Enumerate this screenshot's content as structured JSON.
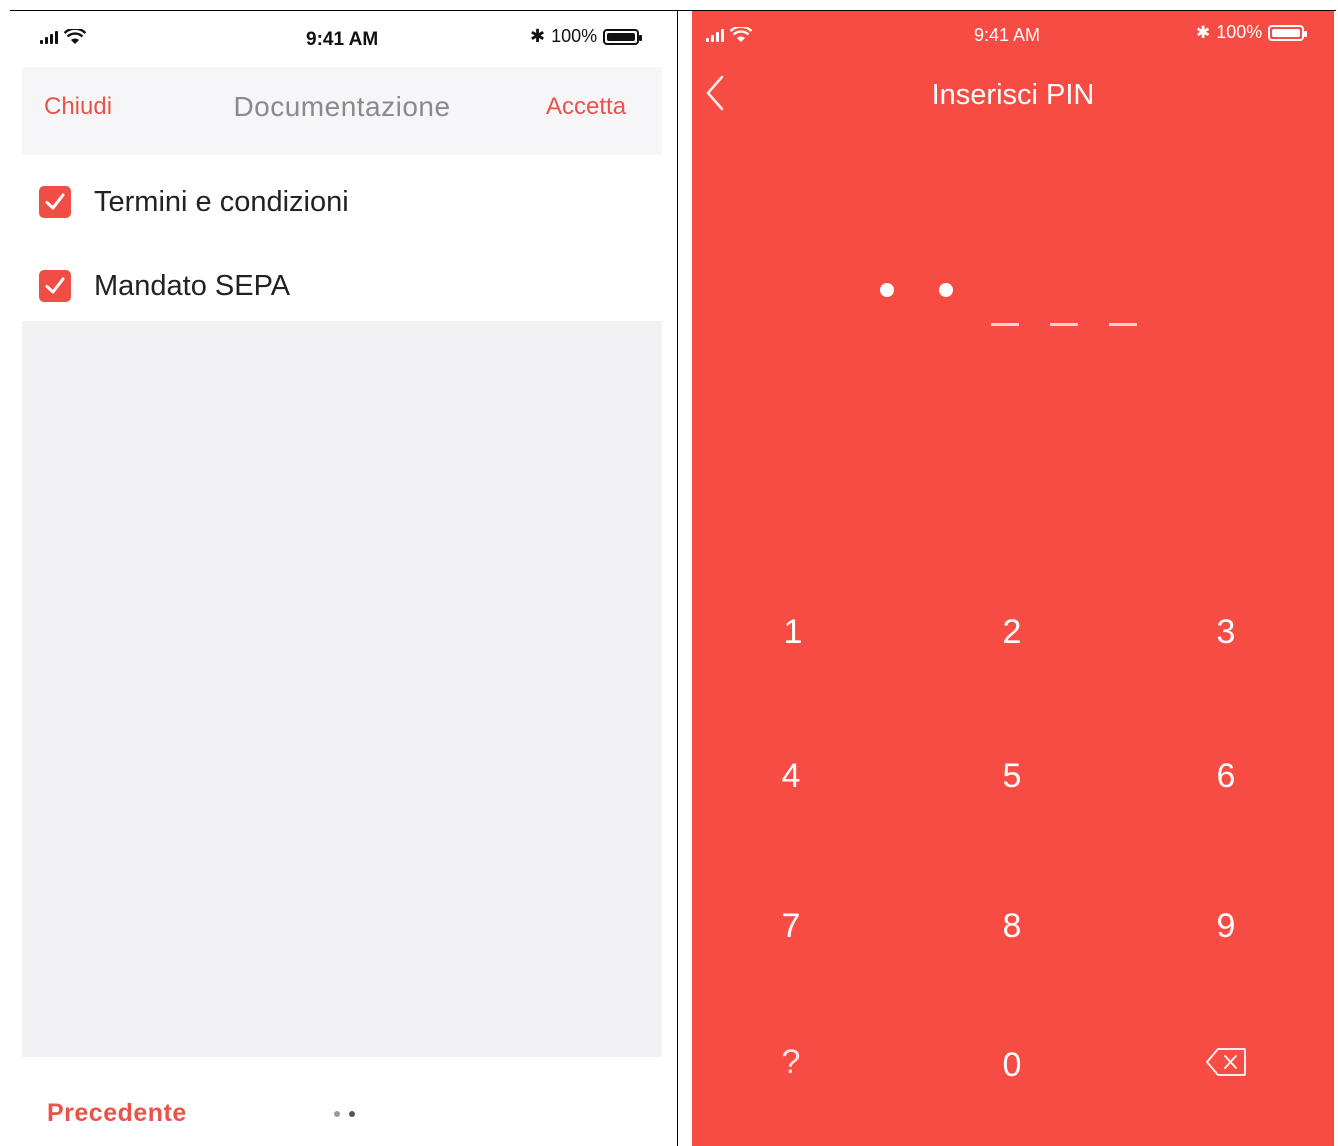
{
  "left_screen": {
    "status_bar": {
      "time": "9:41 AM",
      "battery": "100%"
    },
    "nav": {
      "close": "Chiudi",
      "title": "Documentazione",
      "accept": "Accetta"
    },
    "documents": [
      {
        "label": "Termini e condizioni",
        "checked": true
      },
      {
        "label": "Mandato SEPA",
        "checked": true
      }
    ],
    "footer": {
      "previous": "Precedente",
      "page_count": 2,
      "current_page": 2
    }
  },
  "right_screen": {
    "status_bar": {
      "time": "9:41 AM",
      "battery": "100%"
    },
    "title": "Inserisci PIN",
    "pin": {
      "length": 5,
      "entered": 2
    },
    "keypad": {
      "row1": [
        "1",
        "2",
        "3"
      ],
      "row2": [
        "4",
        "5",
        "6"
      ],
      "row3": [
        "7",
        "8",
        "9"
      ],
      "row4": [
        "?",
        "0"
      ],
      "delete_icon": "backspace-icon"
    }
  },
  "colors": {
    "accent": "#f04e44",
    "pin_background": "#f64c43"
  }
}
